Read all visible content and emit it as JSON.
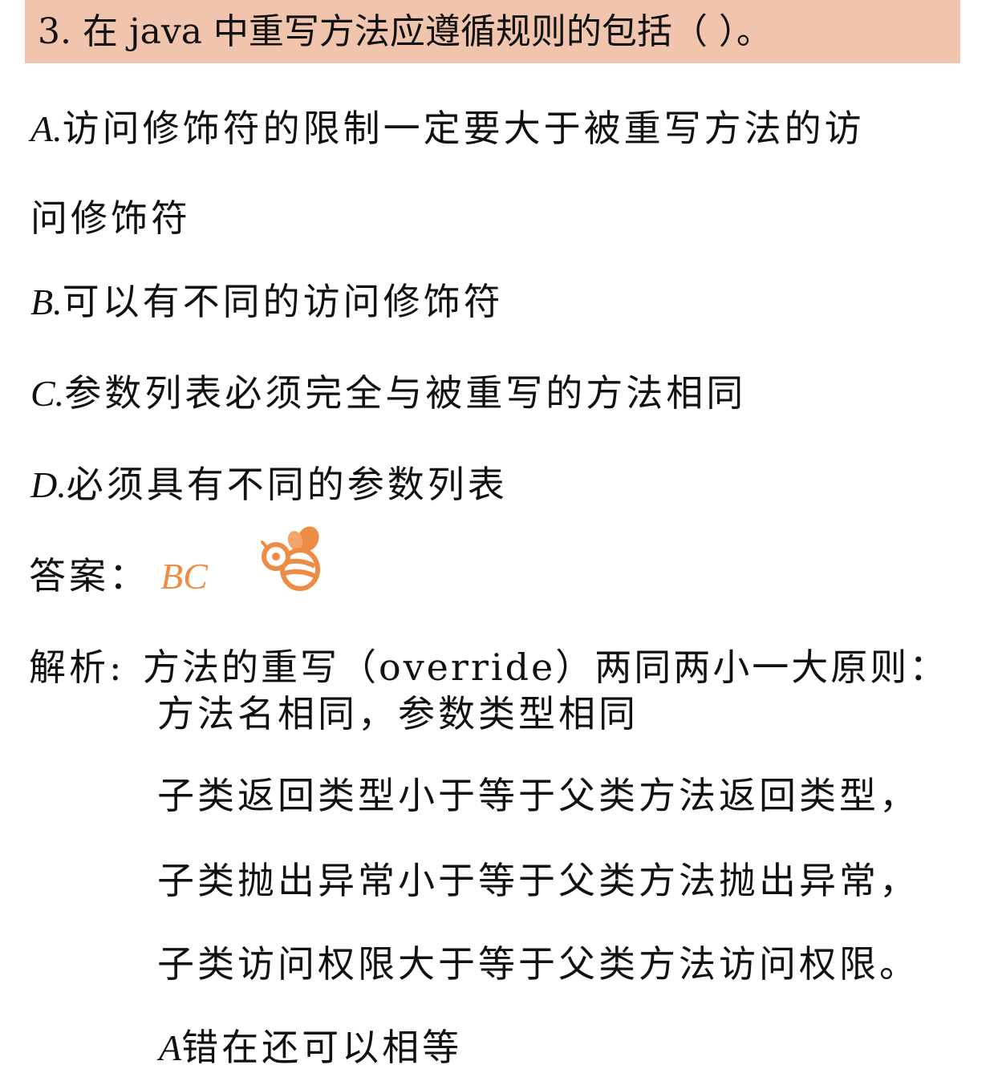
{
  "question": {
    "number": "3.",
    "text": "在 java 中重写方法应遵循规则的包括（    ）。",
    "banner_color": "#f1c4ae"
  },
  "options": [
    {
      "letter": "A.",
      "text": "访问修饰符的限制一定要大于被重写方法的访",
      "text_cont": "问修饰符"
    },
    {
      "letter": "B.",
      "text": "可以有不同的访问修饰符"
    },
    {
      "letter": "C.",
      "text": "参数列表必须完全与被重写的方法相同"
    },
    {
      "letter": "D.",
      "text": "必须具有不同的参数列表"
    }
  ],
  "answer": {
    "label": "答案：",
    "value": "BC",
    "color": "#ec8c45",
    "icon": "bee-icon"
  },
  "explanation": {
    "label": "解析:",
    "lines": [
      "方法的重写（override）两同两小一大原则：",
      "方法名相同，参数类型相同",
      "子类返回类型小于等于父类方法返回类型，",
      "子类抛出异常小于等于父类方法抛出异常，",
      "子类访问权限大于等于父类方法访问权限。"
    ],
    "note_letter": "A",
    "note_text": "错在还可以相等"
  }
}
